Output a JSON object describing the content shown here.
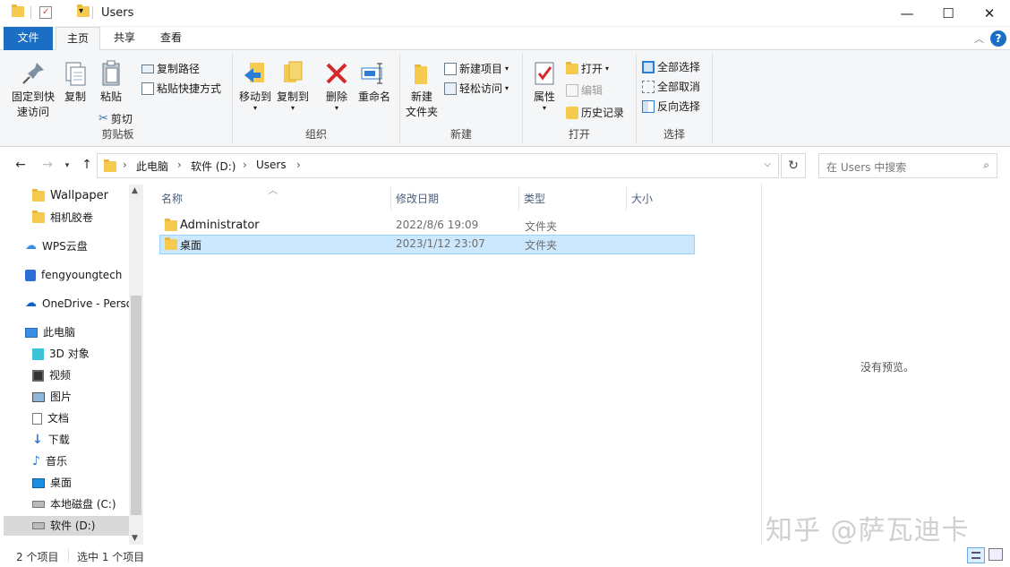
{
  "window": {
    "title": "Users",
    "minimize": "—",
    "maximize": "☐",
    "close": "✕"
  },
  "ribbon_tabs": {
    "file": "文件",
    "home": "主页",
    "share": "共享",
    "view": "查看"
  },
  "ribbon": {
    "clipboard": {
      "label": "剪贴板",
      "pin": "固定到快\n速访问",
      "copy": "复制",
      "paste": "粘贴",
      "copy_path": "复制路径",
      "paste_shortcut": "粘贴快捷方式",
      "cut": "剪切"
    },
    "organize": {
      "label": "组织",
      "move_to": "移动到",
      "copy_to": "复制到",
      "delete": "删除",
      "rename": "重命名"
    },
    "new": {
      "label": "新建",
      "new_folder": "新建\n文件夹",
      "new_item": "新建项目",
      "easy_access": "轻松访问"
    },
    "open": {
      "label": "打开",
      "properties": "属性",
      "open": "打开",
      "edit": "编辑",
      "history": "历史记录"
    },
    "select": {
      "label": "选择",
      "select_all": "全部选择",
      "select_none": "全部取消",
      "invert": "反向选择"
    }
  },
  "address": {
    "crumbs": [
      "此电脑",
      "软件 (D:)",
      "Users"
    ],
    "search_placeholder": "在 Users 中搜索"
  },
  "nav": [
    "Wallpaper",
    "相机胶卷",
    "WPS云盘",
    "fengyoungtech",
    "OneDrive - Perso",
    "此电脑",
    "3D 对象",
    "视频",
    "图片",
    "文档",
    "下载",
    "音乐",
    "桌面",
    "本地磁盘 (C:)",
    "软件 (D:)"
  ],
  "columns": {
    "name": "名称",
    "date": "修改日期",
    "type": "类型",
    "size": "大小"
  },
  "files": [
    {
      "name": "Administrator",
      "date": "2022/8/6 19:09",
      "type": "文件夹"
    },
    {
      "name": "桌面",
      "date": "2023/1/12 23:07",
      "type": "文件夹"
    }
  ],
  "preview": "没有预览。",
  "status": {
    "count": "2 个项目",
    "selected": "选中 1 个项目"
  },
  "watermark": "知乎 @萨瓦迪卡",
  "colors": {
    "accent": "#1a6fc4",
    "selection": "#cce8ff",
    "folder": "#f6c94f"
  }
}
